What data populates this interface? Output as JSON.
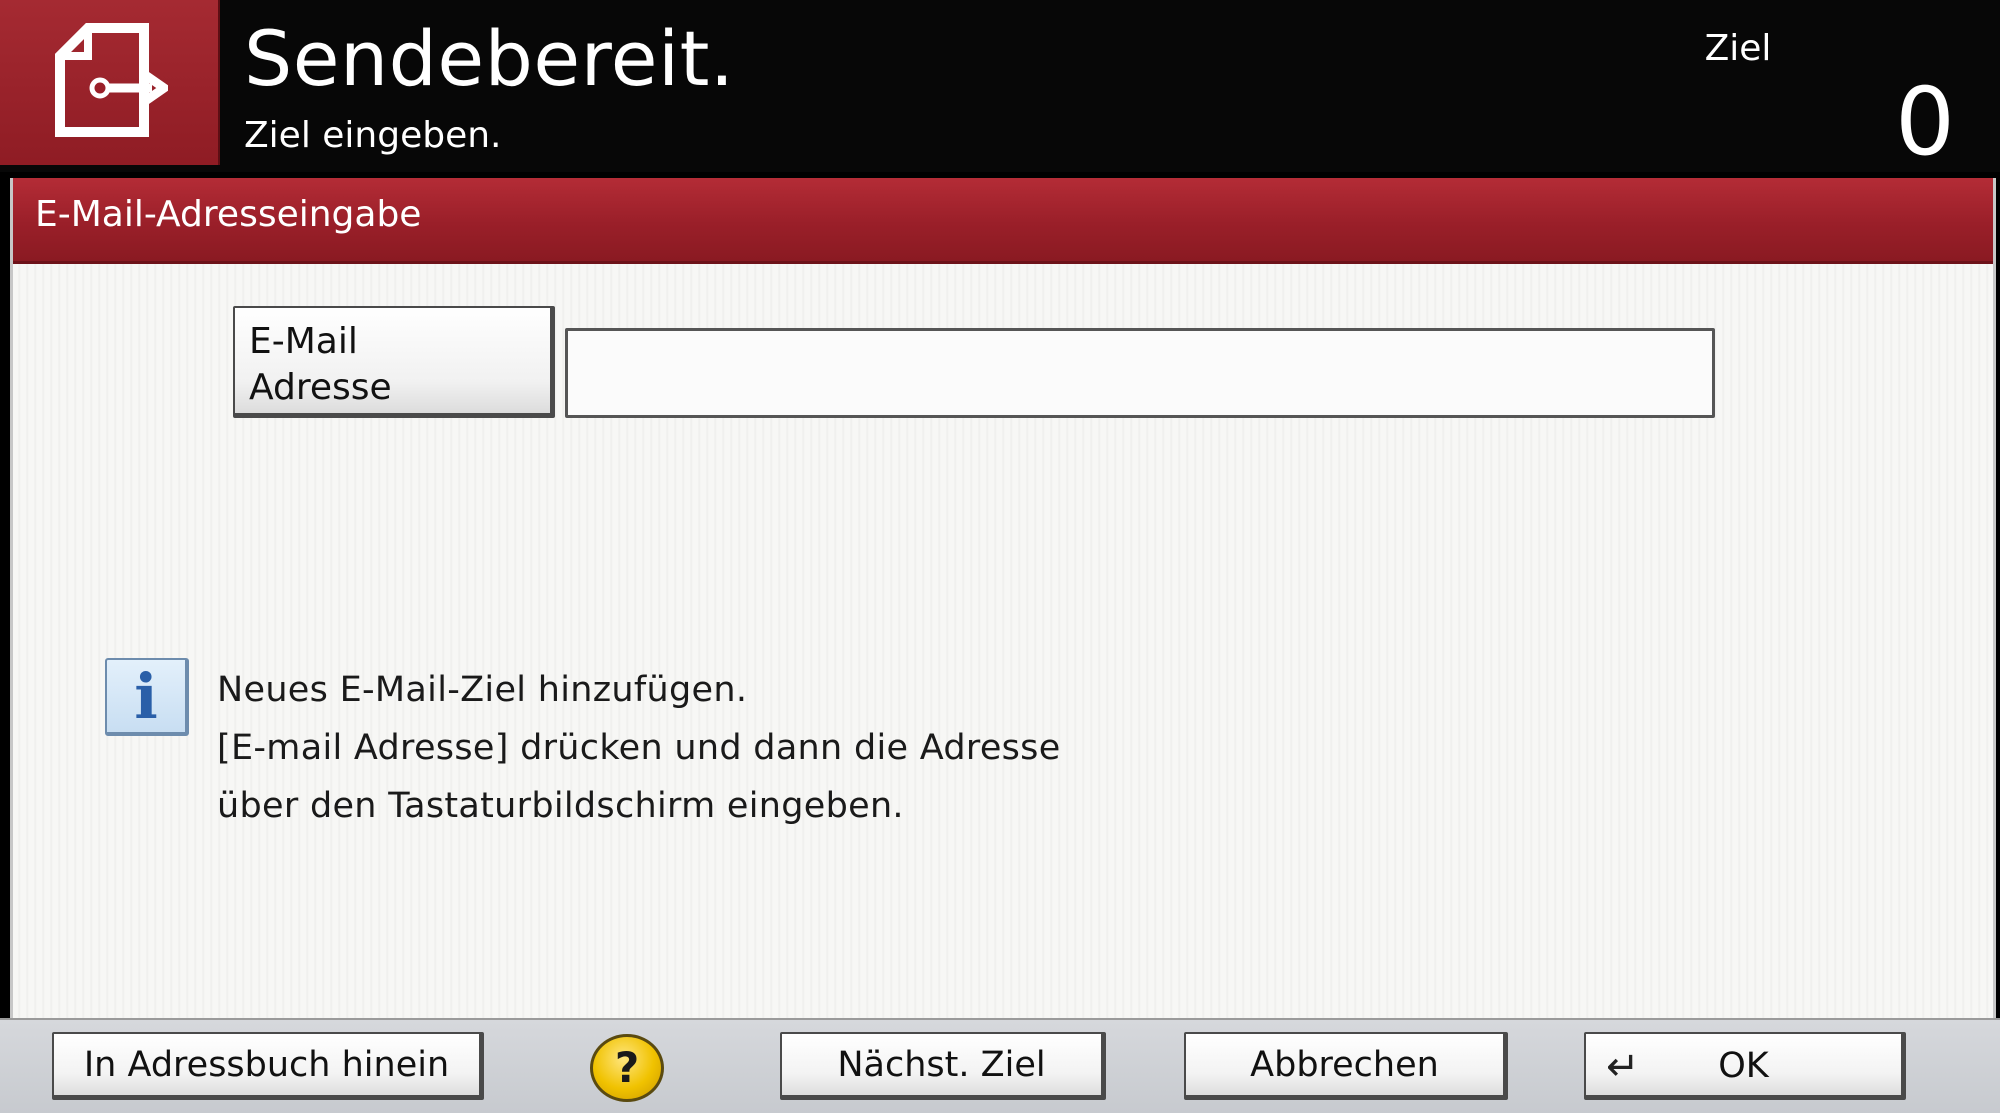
{
  "header": {
    "title": "Sendebereit.",
    "subtitle": "Ziel eingeben.",
    "destination_label": "Ziel",
    "destination_count": "0",
    "mode_icon": "send-document-icon"
  },
  "dialog": {
    "title": "E-Mail-Adresseingabe",
    "email_button": {
      "line1": "E-Mail",
      "line2": "Adresse"
    },
    "email_input": {
      "value": "",
      "placeholder": ""
    },
    "info": {
      "icon": "info-icon",
      "line1": "Neues E-Mail-Ziel hinzufügen.",
      "line2": "[E-mail Adresse] drücken und dann die Adresse",
      "line3": "über den Tastaturbildschirm eingeben."
    }
  },
  "footer": {
    "addressbook_label": "In Adressbuch hinein",
    "help_label": "?",
    "next_label": "Nächst. Ziel",
    "cancel_label": "Abbrechen",
    "ok_label": "OK",
    "ok_icon": "enter-icon"
  },
  "colors": {
    "accent_red": "#9a1f29",
    "background_dark": "#070707",
    "panel_light": "#f7f7f5",
    "help_yellow": "#f0c200"
  }
}
